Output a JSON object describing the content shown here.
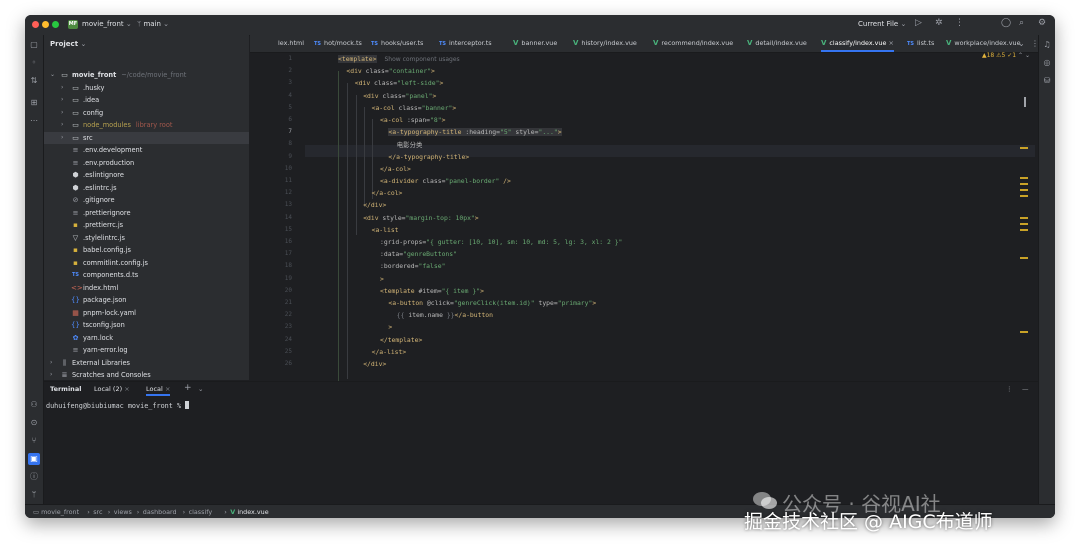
{
  "title_bar": {
    "project_badge": "MF",
    "project_name": "movie_front",
    "branch": "main",
    "run_config": "Current File"
  },
  "project_panel": {
    "header": "Project",
    "tree": [
      {
        "label": "movie_front",
        "hint": "~/code/movie_front",
        "icon": "folder"
      },
      {
        "label": ".husky",
        "icon": "folder"
      },
      {
        "label": ".idea",
        "icon": "folder"
      },
      {
        "label": "config",
        "icon": "folder"
      },
      {
        "label": "node_modules",
        "hint": "library root",
        "icon": "folder"
      },
      {
        "label": "src",
        "icon": "folder"
      },
      {
        "label": ".env.development",
        "icon": "text-lines"
      },
      {
        "label": ".env.production",
        "icon": "text-lines"
      },
      {
        "label": ".eslintignore",
        "icon": "eslint"
      },
      {
        "label": ".eslintrc.js",
        "icon": "eslint"
      },
      {
        "label": ".gitignore",
        "icon": "ignore"
      },
      {
        "label": ".prettierignore",
        "icon": "text-lines"
      },
      {
        "label": ".prettierrc.js",
        "icon": "js"
      },
      {
        "label": ".stylelintrc.js",
        "icon": "stylelint"
      },
      {
        "label": "babel.config.js",
        "icon": "js"
      },
      {
        "label": "commitlint.config.js",
        "icon": "js"
      },
      {
        "label": "components.d.ts",
        "icon": "ts"
      },
      {
        "label": "index.html",
        "icon": "html"
      },
      {
        "label": "package.json",
        "icon": "json"
      },
      {
        "label": "pnpm-lock.yaml",
        "icon": "pnpm"
      },
      {
        "label": "tsconfig.json",
        "icon": "json"
      },
      {
        "label": "yarn.lock",
        "icon": "yarn"
      },
      {
        "label": "yarn-error.log",
        "icon": "text-lines"
      },
      {
        "label": "External Libraries",
        "icon": "library"
      },
      {
        "label": "Scratches and Consoles",
        "icon": "scratches"
      }
    ]
  },
  "tabs": [
    {
      "label": "lex.html",
      "kind": ""
    },
    {
      "label": "hot/mock.ts",
      "kind": "TS"
    },
    {
      "label": "hooks/user.ts",
      "kind": "TS"
    },
    {
      "label": "interceptor.ts",
      "kind": "TS"
    },
    {
      "label": "banner.vue",
      "kind": "V"
    },
    {
      "label": "history/index.vue",
      "kind": "V"
    },
    {
      "label": "recommend/index.vue",
      "kind": "V"
    },
    {
      "label": "detail/index.vue",
      "kind": "V"
    },
    {
      "label": "classify/index.vue",
      "kind": "V"
    },
    {
      "label": "list.ts",
      "kind": "TS"
    },
    {
      "label": "workplace/index.vue",
      "kind": "V"
    }
  ],
  "editor": {
    "inspection_summary": "▲18  ⚠5  ✓1",
    "component_hint": "Show component usages",
    "lines": [
      "<template>",
      "<div class=\"container\">",
      "<div class=\"left-side\">",
      "<div class=\"panel\">",
      "<a-col class=\"banner\">",
      "<a-col :span=\"8\">",
      "<a-typography-title :heading=\"5\" style=\"...\">",
      "电影分类",
      "</a-typography-title>",
      "</a-col>",
      "<a-divider class=\"panel-border\" />",
      "</a-col>",
      "</div>",
      "<div style=\"margin-top: 10px\">",
      "<a-list",
      ":grid-props=\"{ gutter: [10, 10], sm: 10, md: 5, lg: 3, xl: 2 }\"",
      ":data=\"genreButtons\"",
      ":bordered=\"false\"",
      ">",
      "<template #item=\"{ item }\">",
      "<a-button @click=\"genreClick(item.id)\" type=\"primary\">",
      "{{ item.name }}</a-button",
      ">",
      "</template>",
      "</a-list>",
      "</div>"
    ],
    "line_numbers": [
      "1",
      "2",
      "3",
      "4",
      "5",
      "6",
      "7",
      "8",
      "9",
      "10",
      "11",
      "12",
      "13",
      "14",
      "15",
      "16",
      "17",
      "18",
      "19",
      "20",
      "21",
      "22",
      "23",
      "24",
      "25",
      "26"
    ]
  },
  "terminal": {
    "title": "Terminal",
    "tabs": [
      "Local (2)",
      "Local"
    ],
    "prompt": "duhuifeng@biubiumac movie_front % "
  },
  "status_bar": {
    "breadcrumb": [
      "movie_front",
      "src",
      "views",
      "dashboard",
      "classify",
      "index.vue"
    ]
  },
  "watermark": {
    "line1": "公众号 · 谷视AI社",
    "line2": "掘金技术社区 @ AIGC布道师"
  }
}
